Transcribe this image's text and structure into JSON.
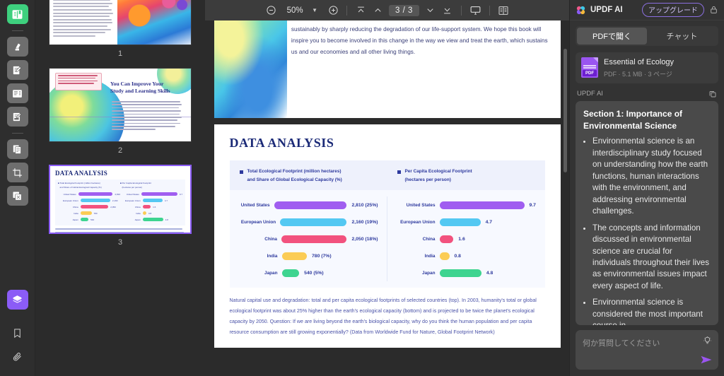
{
  "tool_rail": {
    "items": [
      {
        "name": "reader-mode-icon",
        "label": "Reader"
      },
      {
        "name": "highlight-icon",
        "label": "Highlight"
      },
      {
        "name": "annotate-icon",
        "label": "Annotate"
      },
      {
        "name": "edit-pdf-icon",
        "label": "Edit PDF"
      },
      {
        "name": "sign-icon",
        "label": "Sign"
      },
      {
        "name": "organize-pages-icon",
        "label": "Organize Pages"
      },
      {
        "name": "crop-icon",
        "label": "Crop"
      },
      {
        "name": "convert-icon",
        "label": "Convert"
      },
      {
        "name": "ai-layers-icon",
        "label": "UPDF AI"
      },
      {
        "name": "bookmark-icon",
        "label": "Bookmark"
      },
      {
        "name": "attachment-icon",
        "label": "Attachment"
      }
    ]
  },
  "thumbnails": {
    "pages": [
      {
        "number": "1",
        "selected": false
      },
      {
        "number": "2",
        "selected": false
      },
      {
        "number": "3",
        "selected": true
      }
    ],
    "page2": {
      "heading_line1": "You Can Improve Your",
      "heading_line2": "Study and Learning Skills"
    },
    "page3": {
      "title": "DATA ANALYSIS"
    }
  },
  "toolbar": {
    "zoom_out_icon": "minus-circle-icon",
    "zoom_value": "50%",
    "zoom_dropdown_icon": "chevron-down-icon",
    "zoom_in_icon": "plus-circle-icon",
    "first_page_icon": "first-page-icon",
    "prev_page_icon": "prev-page-icon",
    "page_indicator": "3 / 3",
    "next_page_icon": "next-page-icon",
    "last_page_icon": "last-page-icon",
    "presentation_icon": "presentation-icon",
    "view_mode_icon": "book-view-icon"
  },
  "document": {
    "page_top_text": "sustainably by sharply reducing the degradation of our life-support system. We hope this book will inspire you to become involved in this change in the way we view and treat the earth, which sustains us and our economies and all other living things.",
    "title": "DATA ANALYSIS",
    "legend_left_line1": "Total Ecological Footprint (million hectares)",
    "legend_left_line2": "and Share of Global Ecological Capacity (%)",
    "legend_right_line1": "Per Capita Ecological Footprint",
    "legend_right_line2": "(hectares per person)",
    "caption": "Natural capital use and degradation: total and per capita ecological footprints of selected countries (top). In 2003, humanity's total or global ecological footprint was about 25% higher than the earth's ecological capacity (bottom) and is projected to be twice the planet's ecological capacity by 2050. Question: If we are living beyond the earth's biological capacity, why do you think the human population and per capita resource consumption are still growing exponentially? (Data from Worldwide Fund for Nature, Global Footprint Network)"
  },
  "chart_data": [
    {
      "type": "bar",
      "title": "Total Ecological Footprint (million hectares) and Share of Global Ecological Capacity (%)",
      "orientation": "horizontal",
      "categories": [
        "United States",
        "European Union",
        "China",
        "India",
        "Japan"
      ],
      "values": [
        2810,
        2160,
        2050,
        780,
        540
      ],
      "share_pct": [
        25,
        19,
        18,
        7,
        5
      ],
      "value_labels": [
        "2,810 (25%)",
        "2,160 (19%)",
        "2,050 (18%)",
        "780 (7%)",
        "540 (5%)"
      ],
      "colors": [
        "#a05ef0",
        "#54c8f2",
        "#f2527e",
        "#fbcc55",
        "#3ed490"
      ],
      "xlabel": "",
      "ylabel": "",
      "xlim": [
        0,
        2810
      ],
      "grid": false,
      "legend": "none"
    },
    {
      "type": "bar",
      "title": "Per Capita Ecological Footprint (hectares per person)",
      "orientation": "horizontal",
      "categories": [
        "United States",
        "European Union",
        "China",
        "India",
        "Japan"
      ],
      "values": [
        9.7,
        4.7,
        1.6,
        0.8,
        4.8
      ],
      "value_labels": [
        "9.7",
        "4.7",
        "1.6",
        "0.8",
        "4.8"
      ],
      "colors": [
        "#a05ef0",
        "#54c8f2",
        "#f2527e",
        "#fbcc55",
        "#3ed490"
      ],
      "xlabel": "",
      "ylabel": "",
      "xlim": [
        0,
        9.7
      ],
      "grid": false,
      "legend": "none"
    }
  ],
  "ai_panel": {
    "logo_icon": "updf-logo-icon",
    "title": "UPDF AI",
    "upgrade_label": "アップグレード",
    "lock_icon": "lock-icon",
    "tabs": [
      {
        "label": "PDFで聞く",
        "active": true
      },
      {
        "label": "チャット",
        "active": false
      }
    ],
    "file": {
      "icon": "pdf-file-icon",
      "badge": "PDF",
      "name": "Essential of Ecology",
      "meta": "PDF · 5.1 MB · 3 ページ"
    },
    "response_label": "UPDF AI",
    "copy_icon": "copy-icon",
    "response": {
      "section_title": "Section 1: Importance of Environmental Science",
      "bullets": [
        "Environmental science is an interdisciplinary study focused on understanding how the earth functions, human interactions with the environment, and addressing environmental challenges.",
        "The concepts and information discussed in environmental science are crucial for individuals throughout their lives as environmental issues impact every aspect of life.",
        "Environmental science is considered the most important course in"
      ]
    },
    "input": {
      "placeholder": "何か質問してください",
      "bulb_icon": "lightbulb-icon",
      "send_icon": "send-icon"
    }
  }
}
